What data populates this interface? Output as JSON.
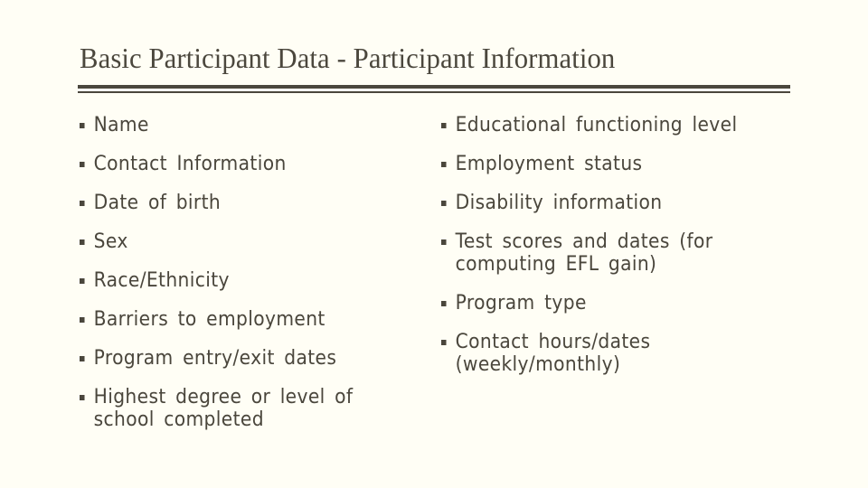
{
  "slide": {
    "title": "Basic Participant Data - Participant Information",
    "bullet_icon": "square-bullet",
    "colors": {
      "background": "#fffef5",
      "text": "#4a463c",
      "rule": "#4b473d"
    },
    "left_column": [
      "Name",
      "Contact Information",
      "Date of birth",
      "Sex",
      "Race/Ethnicity",
      "Barriers to employment",
      "Program entry/exit dates",
      "Highest degree or level of school completed"
    ],
    "right_column": [
      "Educational functioning level",
      "Employment status",
      "Disability information",
      "Test scores and dates (for computing EFL gain)",
      "Program type",
      "Contact hours/dates (weekly/monthly)"
    ]
  }
}
